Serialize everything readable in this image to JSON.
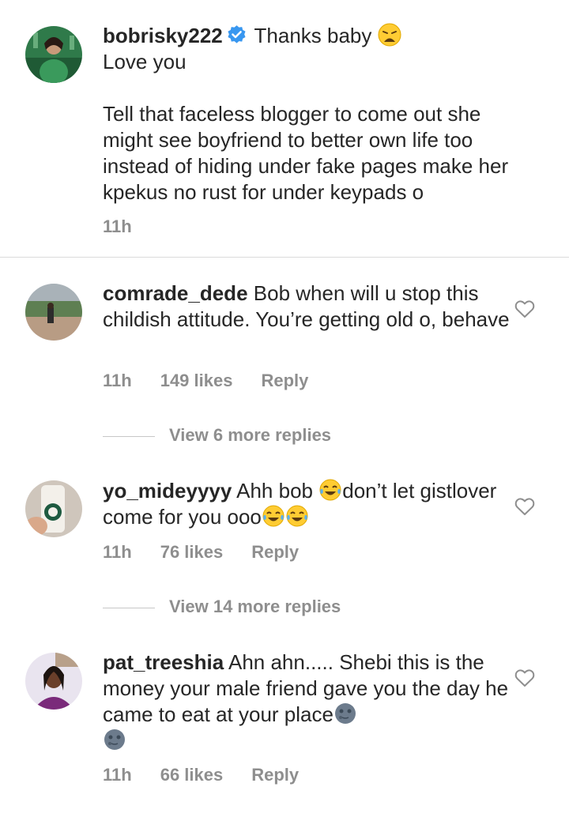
{
  "comments": [
    {
      "username": "bobrisky222",
      "verified": true,
      "text_lines": [
        "Thanks baby"
      ],
      "text_extra": "Love you",
      "text_para": "Tell that faceless blogger to come out she might see boyfriend to better own life too instead of hiding under fake pages make her kpekus no rust for under keypads o",
      "time": "11h",
      "avatar_icon": "profile-photo"
    },
    {
      "username": "comrade_dede",
      "text": "Bob when will u stop this childish attitude. You’re getting old o, behave",
      "time": "11h",
      "likes": "149 likes",
      "reply": "Reply",
      "view_more": "View 6 more replies"
    },
    {
      "username": "yo_mideyyyy",
      "text_a": "Ahh bob",
      "text_b": "don’t let gistlover come for you ooo",
      "time": "11h",
      "likes": "76 likes",
      "reply": "Reply",
      "view_more": "View 14 more replies"
    },
    {
      "username": "pat_treeshia",
      "text": "Ahn ahn..... Shebi this is the money your male friend gave you the day he came to eat at your place",
      "time": "11h",
      "likes": "66 likes",
      "reply": "Reply"
    }
  ],
  "colors": {
    "text": "#262626",
    "meta": "#8e8e8e",
    "verified": "#3897f0",
    "divider": "#dbdbdb"
  },
  "icons": {
    "heart": "heart-outline-icon",
    "verified": "verified-badge-icon",
    "emoji_weary": "weary-face-emoji",
    "emoji_laugh": "tears-of-joy-emoji",
    "emoji_moon": "new-moon-face-emoji"
  }
}
